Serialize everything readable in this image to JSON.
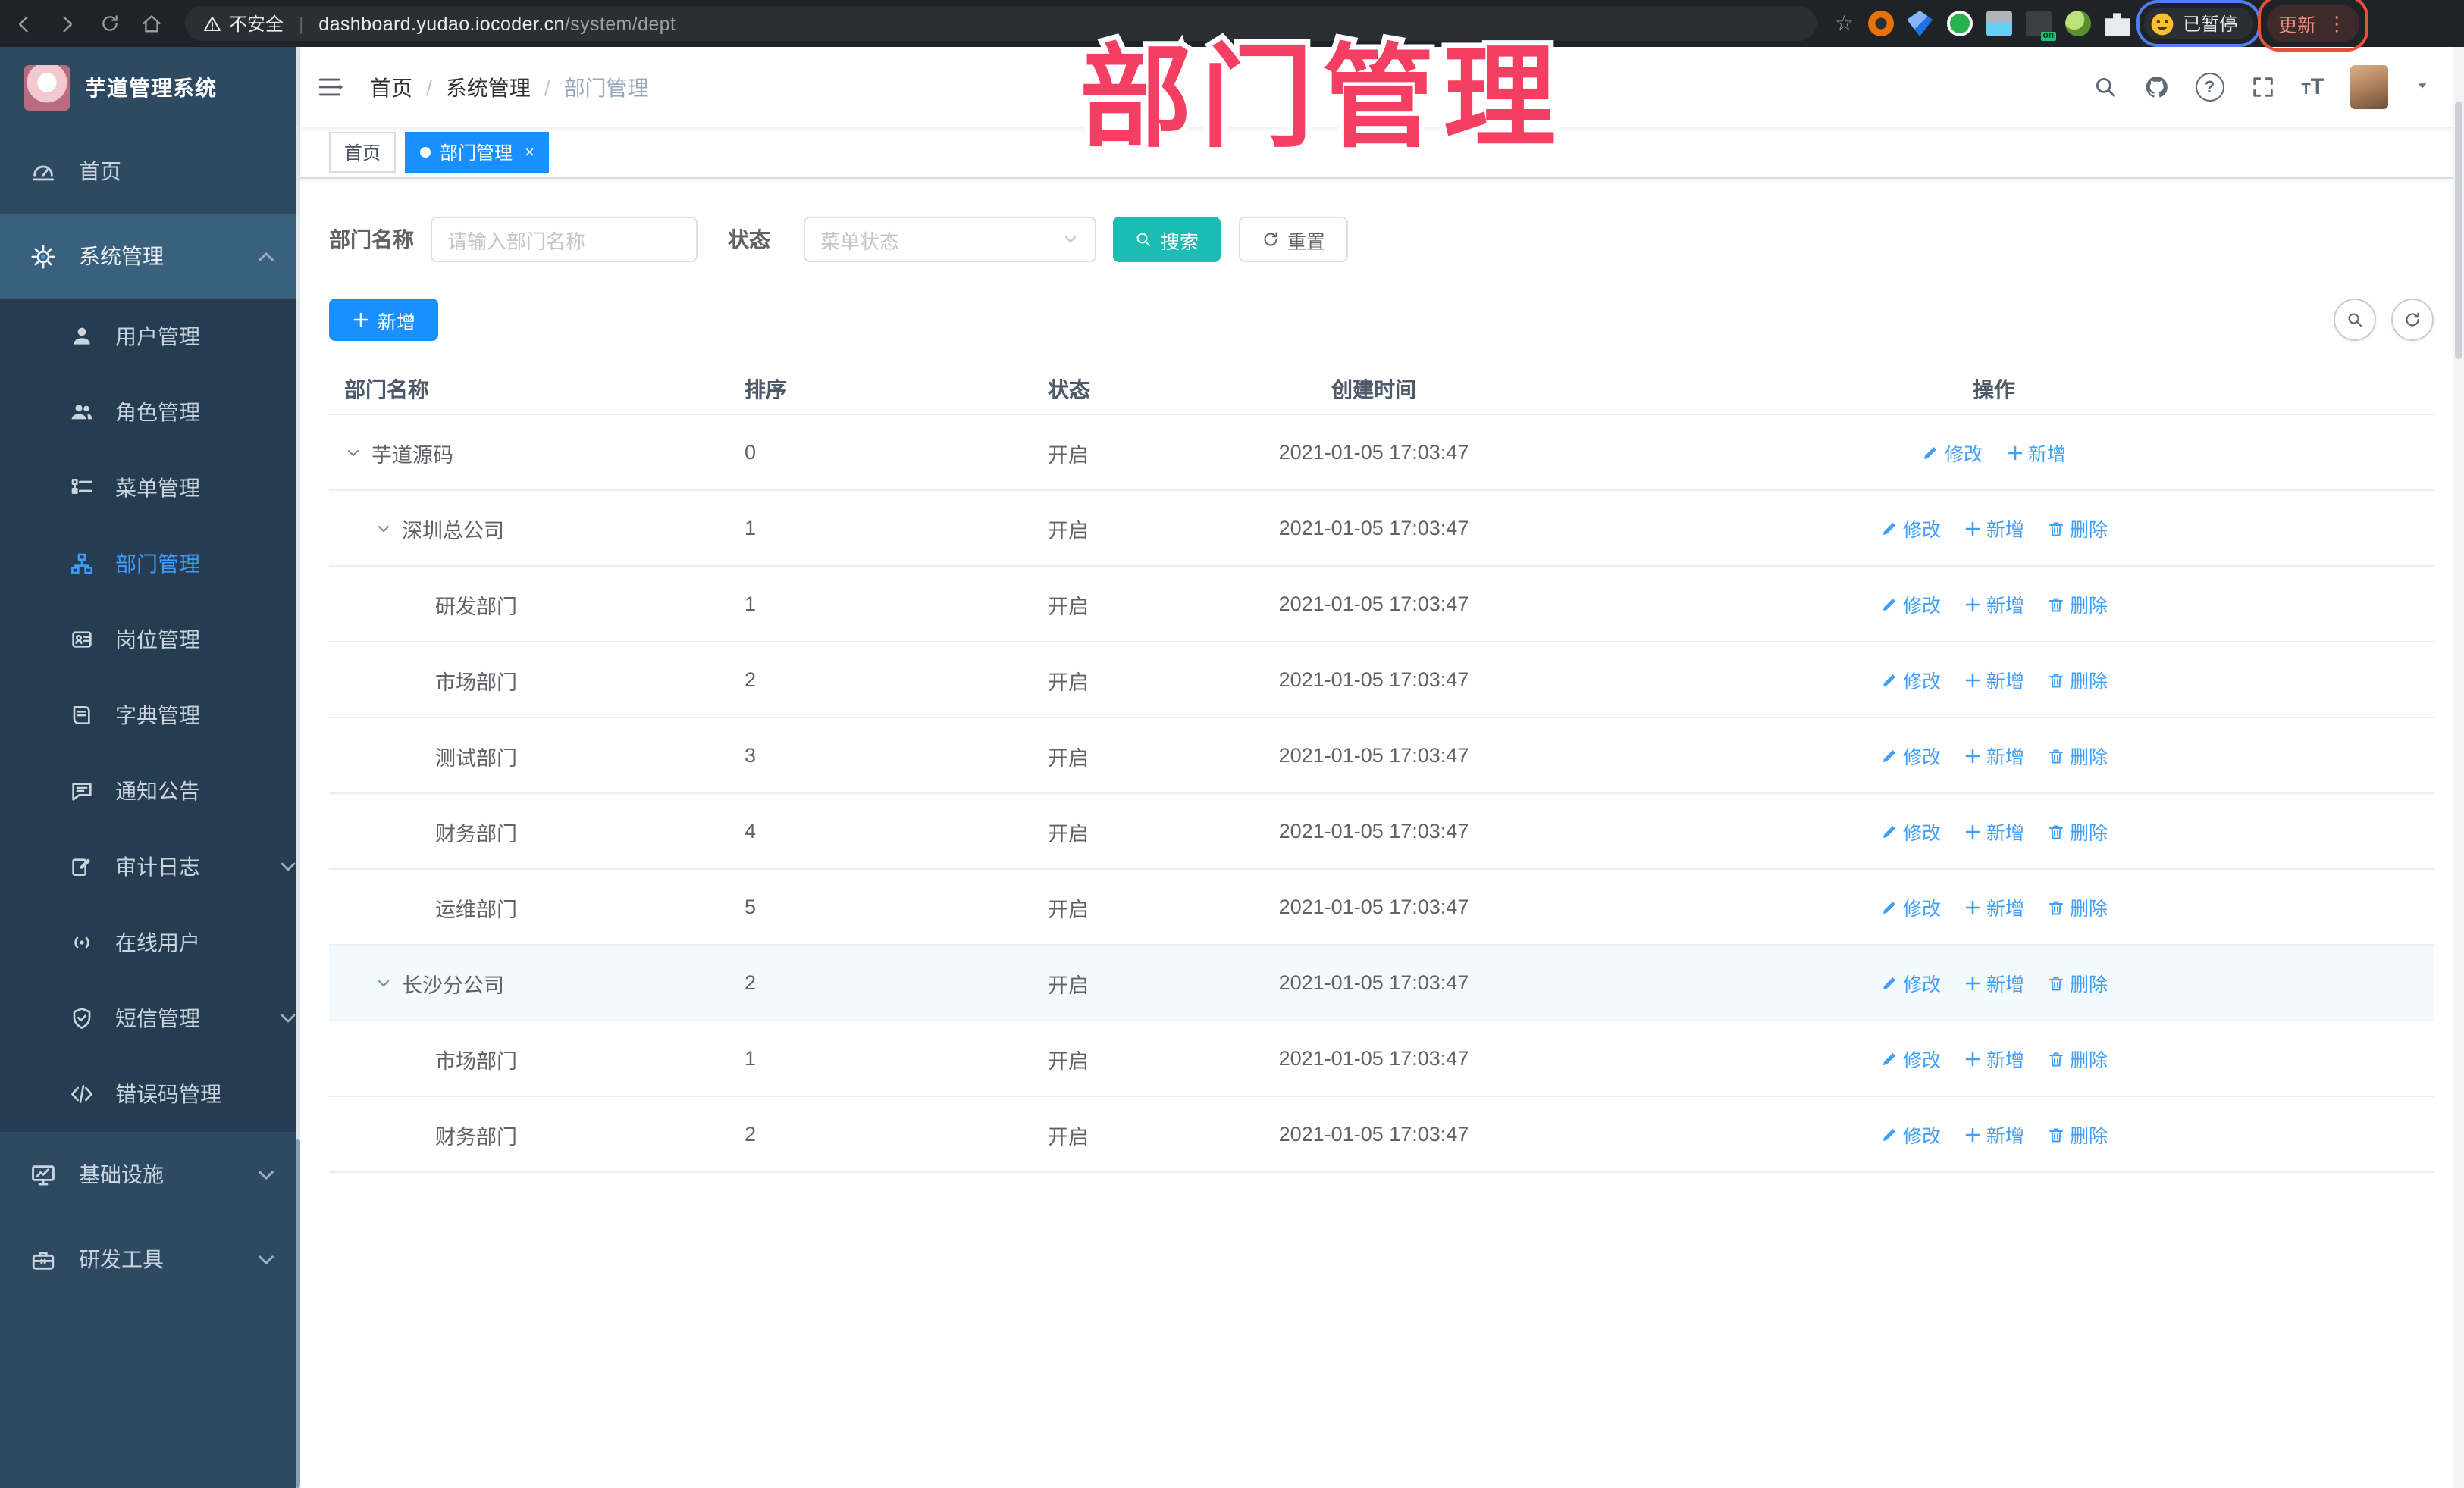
{
  "browser": {
    "security_warning": "不安全",
    "url_host": "dashboard.yudao.iocoder.cn",
    "url_path": "/system/dept",
    "profile_status": "已暂停",
    "update_button": "更新",
    "extension_badge": "on"
  },
  "watermark_text": "部门管理",
  "colors": {
    "primary_blue": "#1890ff",
    "link_blue": "#409eff",
    "search_teal": "#1cbbb4",
    "annotation_pink": "#f43f63",
    "sidebar_bg": "#2e4a63",
    "submenu_bg": "#253c51"
  },
  "icons": [
    "back-icon",
    "forward-icon",
    "reload-icon",
    "home-icon",
    "warning-icon",
    "star-icon",
    "puzzle-icon",
    "kebab-icon",
    "hamburger-icon",
    "search-icon",
    "github-icon",
    "help-icon",
    "fullscreen-icon",
    "font-size-icon",
    "caret-down-icon",
    "dashboard-icon",
    "gear-icon",
    "user-icon",
    "users-icon",
    "menu-tree-icon",
    "org-tree-icon",
    "badge-icon",
    "book-icon",
    "bubble-icon",
    "log-icon",
    "online-icon",
    "shield-icon",
    "code-icon",
    "monitor-icon",
    "toolbox-icon",
    "edit-icon",
    "plus-icon",
    "trash-icon",
    "refresh-icon",
    "chevron-up-icon",
    "chevron-down-icon",
    "close-icon"
  ],
  "sidebar": {
    "app_title": "芋道管理系统",
    "items": [
      {
        "label": "首页",
        "icon": "dashboard"
      },
      {
        "label": "系统管理",
        "icon": "gear",
        "expanded": true,
        "children": [
          {
            "label": "用户管理",
            "icon": "user"
          },
          {
            "label": "角色管理",
            "icon": "users"
          },
          {
            "label": "菜单管理",
            "icon": "menutree"
          },
          {
            "label": "部门管理",
            "icon": "orgtree",
            "active": true
          },
          {
            "label": "岗位管理",
            "icon": "badge"
          },
          {
            "label": "字典管理",
            "icon": "book"
          },
          {
            "label": "通知公告",
            "icon": "bubble"
          },
          {
            "label": "审计日志",
            "icon": "log",
            "collapsible": true
          },
          {
            "label": "在线用户",
            "icon": "online"
          },
          {
            "label": "短信管理",
            "icon": "shield",
            "collapsible": true
          },
          {
            "label": "错误码管理",
            "icon": "code"
          }
        ]
      },
      {
        "label": "基础设施",
        "icon": "monitor",
        "collapsible": true
      },
      {
        "label": "研发工具",
        "icon": "toolbox",
        "collapsible": true
      }
    ]
  },
  "header": {
    "breadcrumb": [
      "首页",
      "系统管理",
      "部门管理"
    ]
  },
  "tabs": [
    {
      "label": "首页",
      "active": false
    },
    {
      "label": "部门管理",
      "active": true,
      "closable": true
    }
  ],
  "filter": {
    "name_label": "部门名称",
    "name_placeholder": "请输入部门名称",
    "status_label": "状态",
    "status_placeholder": "菜单状态",
    "search_label": "搜索",
    "reset_label": "重置"
  },
  "toolbar": {
    "add_label": "新增"
  },
  "table": {
    "columns": [
      "部门名称",
      "排序",
      "状态",
      "创建时间",
      "操作"
    ],
    "rows": [
      {
        "name": "芋道源码",
        "level": 0,
        "expandable": true,
        "sort": "0",
        "status": "开启",
        "created": "2021-01-05 17:03:47",
        "actions": [
          "修改",
          "新增"
        ]
      },
      {
        "name": "深圳总公司",
        "level": 1,
        "expandable": true,
        "sort": "1",
        "status": "开启",
        "created": "2021-01-05 17:03:47",
        "actions": [
          "修改",
          "新增",
          "删除"
        ]
      },
      {
        "name": "研发部门",
        "level": 2,
        "expandable": false,
        "sort": "1",
        "status": "开启",
        "created": "2021-01-05 17:03:47",
        "actions": [
          "修改",
          "新增",
          "删除"
        ]
      },
      {
        "name": "市场部门",
        "level": 2,
        "expandable": false,
        "sort": "2",
        "status": "开启",
        "created": "2021-01-05 17:03:47",
        "actions": [
          "修改",
          "新增",
          "删除"
        ]
      },
      {
        "name": "测试部门",
        "level": 2,
        "expandable": false,
        "sort": "3",
        "status": "开启",
        "created": "2021-01-05 17:03:47",
        "actions": [
          "修改",
          "新增",
          "删除"
        ]
      },
      {
        "name": "财务部门",
        "level": 2,
        "expandable": false,
        "sort": "4",
        "status": "开启",
        "created": "2021-01-05 17:03:47",
        "actions": [
          "修改",
          "新增",
          "删除"
        ]
      },
      {
        "name": "运维部门",
        "level": 2,
        "expandable": false,
        "sort": "5",
        "status": "开启",
        "created": "2021-01-05 17:03:47",
        "actions": [
          "修改",
          "新增",
          "删除"
        ]
      },
      {
        "name": "长沙分公司",
        "level": 1,
        "expandable": true,
        "sort": "2",
        "status": "开启",
        "created": "2021-01-05 17:03:47",
        "actions": [
          "修改",
          "新增",
          "删除"
        ],
        "highlight": true
      },
      {
        "name": "市场部门",
        "level": 2,
        "expandable": false,
        "sort": "1",
        "status": "开启",
        "created": "2021-01-05 17:03:47",
        "actions": [
          "修改",
          "新增",
          "删除"
        ]
      },
      {
        "name": "财务部门",
        "level": 2,
        "expandable": false,
        "sort": "2",
        "status": "开启",
        "created": "2021-01-05 17:03:47",
        "actions": [
          "修改",
          "新增",
          "删除"
        ]
      }
    ]
  }
}
